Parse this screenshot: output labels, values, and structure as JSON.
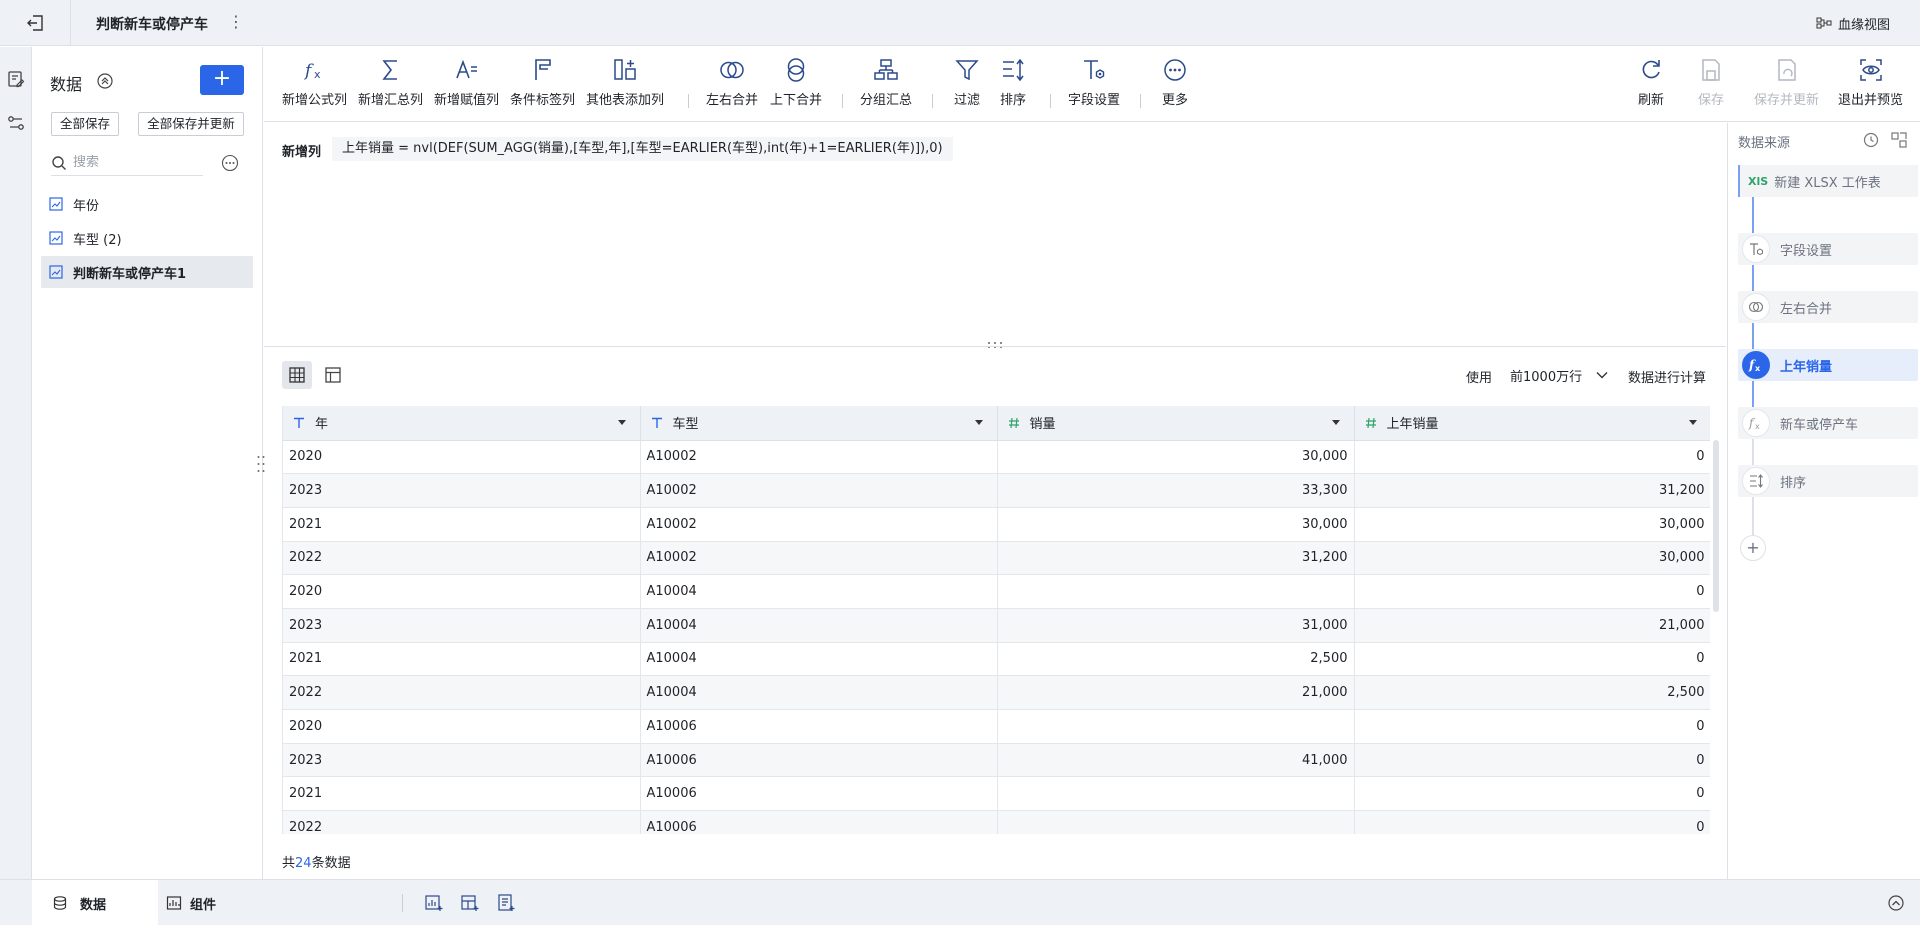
{
  "topbar": {
    "title": "判断新车或停产车",
    "lineage_label": "血缘视图"
  },
  "datapanel": {
    "title": "数据",
    "add_label": "+",
    "save_all": "全部保存",
    "save_all_update": "全部保存并更新",
    "search_placeholder": "搜索",
    "items": [
      {
        "label": "年份"
      },
      {
        "label": "车型 (2)"
      },
      {
        "label": "判断新车或停产车1"
      }
    ]
  },
  "toolbar": {
    "items": [
      {
        "label": "新增公式列",
        "icon": "formula-icon"
      },
      {
        "label": "新增汇总列",
        "icon": "sigma-icon"
      },
      {
        "label": "新增赋值列",
        "icon": "assign-icon"
      },
      {
        "label": "条件标签列",
        "icon": "flag-icon"
      },
      {
        "label": "其他表添加列",
        "icon": "table-add-icon"
      },
      {
        "label": "左右合并",
        "icon": "merge-lr-icon"
      },
      {
        "label": "上下合并",
        "icon": "merge-ud-icon"
      },
      {
        "label": "分组汇总",
        "icon": "group-icon"
      },
      {
        "label": "过滤",
        "icon": "filter-icon"
      },
      {
        "label": "排序",
        "icon": "sort-icon"
      },
      {
        "label": "字段设置",
        "icon": "field-settings-icon"
      },
      {
        "label": "更多",
        "icon": "more-icon"
      }
    ],
    "right": [
      {
        "label": "刷新",
        "icon": "refresh-icon"
      },
      {
        "label": "保存",
        "icon": "save-icon"
      },
      {
        "label": "保存并更新",
        "icon": "save-update-icon"
      },
      {
        "label": "退出并预览",
        "icon": "preview-icon"
      }
    ]
  },
  "formula": {
    "label": "新增列",
    "text": "上年销量 = nvl(DEF(SUM_AGG(销量),[车型,年],[车型=EARLIER(车型),int(年)+1=EARLIER(年)]),0)"
  },
  "preview": {
    "use_label": "使用",
    "rows_option": "前1000万行",
    "calc_label": "数据进行计算",
    "columns": [
      {
        "label": "年",
        "type": "text"
      },
      {
        "label": "车型",
        "type": "text"
      },
      {
        "label": "销量",
        "type": "number"
      },
      {
        "label": "上年销量",
        "type": "number"
      }
    ],
    "rows": [
      [
        "2020",
        "A10002",
        "30,000",
        "0"
      ],
      [
        "2023",
        "A10002",
        "33,300",
        "31,200"
      ],
      [
        "2021",
        "A10002",
        "30,000",
        "30,000"
      ],
      [
        "2022",
        "A10002",
        "31,200",
        "30,000"
      ],
      [
        "2020",
        "A10004",
        "",
        "0"
      ],
      [
        "2023",
        "A10004",
        "31,000",
        "21,000"
      ],
      [
        "2021",
        "A10004",
        "2,500",
        "0"
      ],
      [
        "2022",
        "A10004",
        "21,000",
        "2,500"
      ],
      [
        "2020",
        "A10006",
        "",
        "0"
      ],
      [
        "2023",
        "A10006",
        "41,000",
        "0"
      ],
      [
        "2021",
        "A10006",
        "",
        "0"
      ],
      [
        "2022",
        "A10006",
        "",
        "0"
      ]
    ],
    "total_prefix": "共",
    "total_count": "24",
    "total_suffix": "条数据"
  },
  "rightpanel": {
    "title": "数据来源",
    "source_badge": "XlS",
    "source_label": "新建 XLSX 工作表",
    "steps": [
      {
        "label": "字段设置",
        "icon": "field-settings-icon"
      },
      {
        "label": "左右合并",
        "icon": "merge-lr-icon"
      },
      {
        "label": "上年销量",
        "icon": "formula-icon"
      },
      {
        "label": "新车或停产车",
        "icon": "formula-icon"
      },
      {
        "label": "排序",
        "icon": "sort-icon"
      }
    ],
    "add_label": "+"
  },
  "bottombar": {
    "tab_data": "数据",
    "tab_components": "组件"
  },
  "colors": {
    "accent": "#2c66e8",
    "toolbar_icon": "#2b4a8c",
    "disabled": "#b4b9c1"
  }
}
